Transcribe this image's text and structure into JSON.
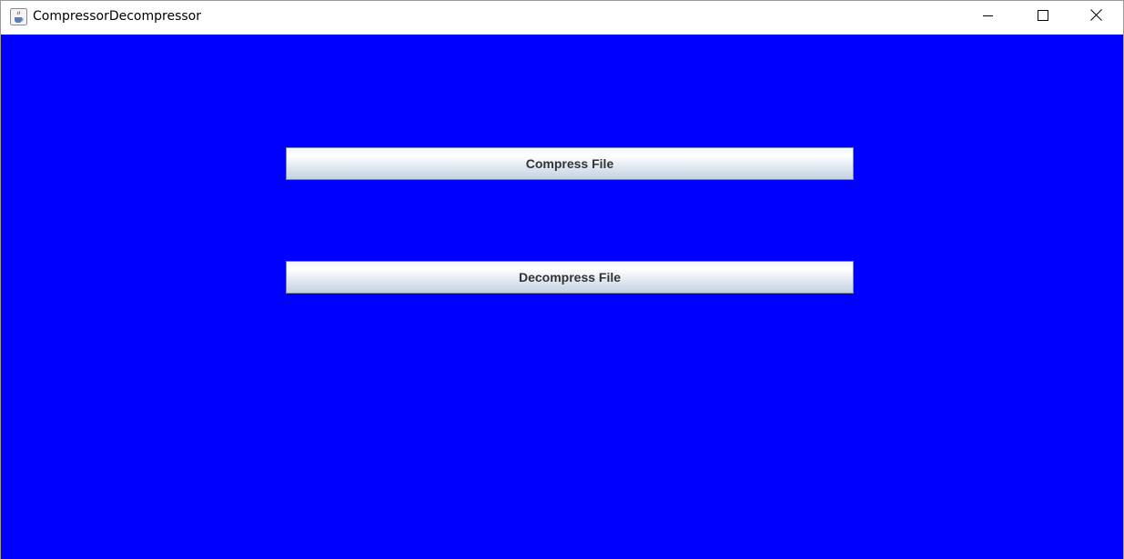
{
  "window": {
    "title": "CompressorDecompressor",
    "icon": "java-cup-icon",
    "controls": [
      "minimize-icon",
      "maximize-icon",
      "close-icon"
    ]
  },
  "content": {
    "background_color": "#0000ff",
    "compress_label": "Compress File",
    "decompress_label": "Decompress File"
  }
}
